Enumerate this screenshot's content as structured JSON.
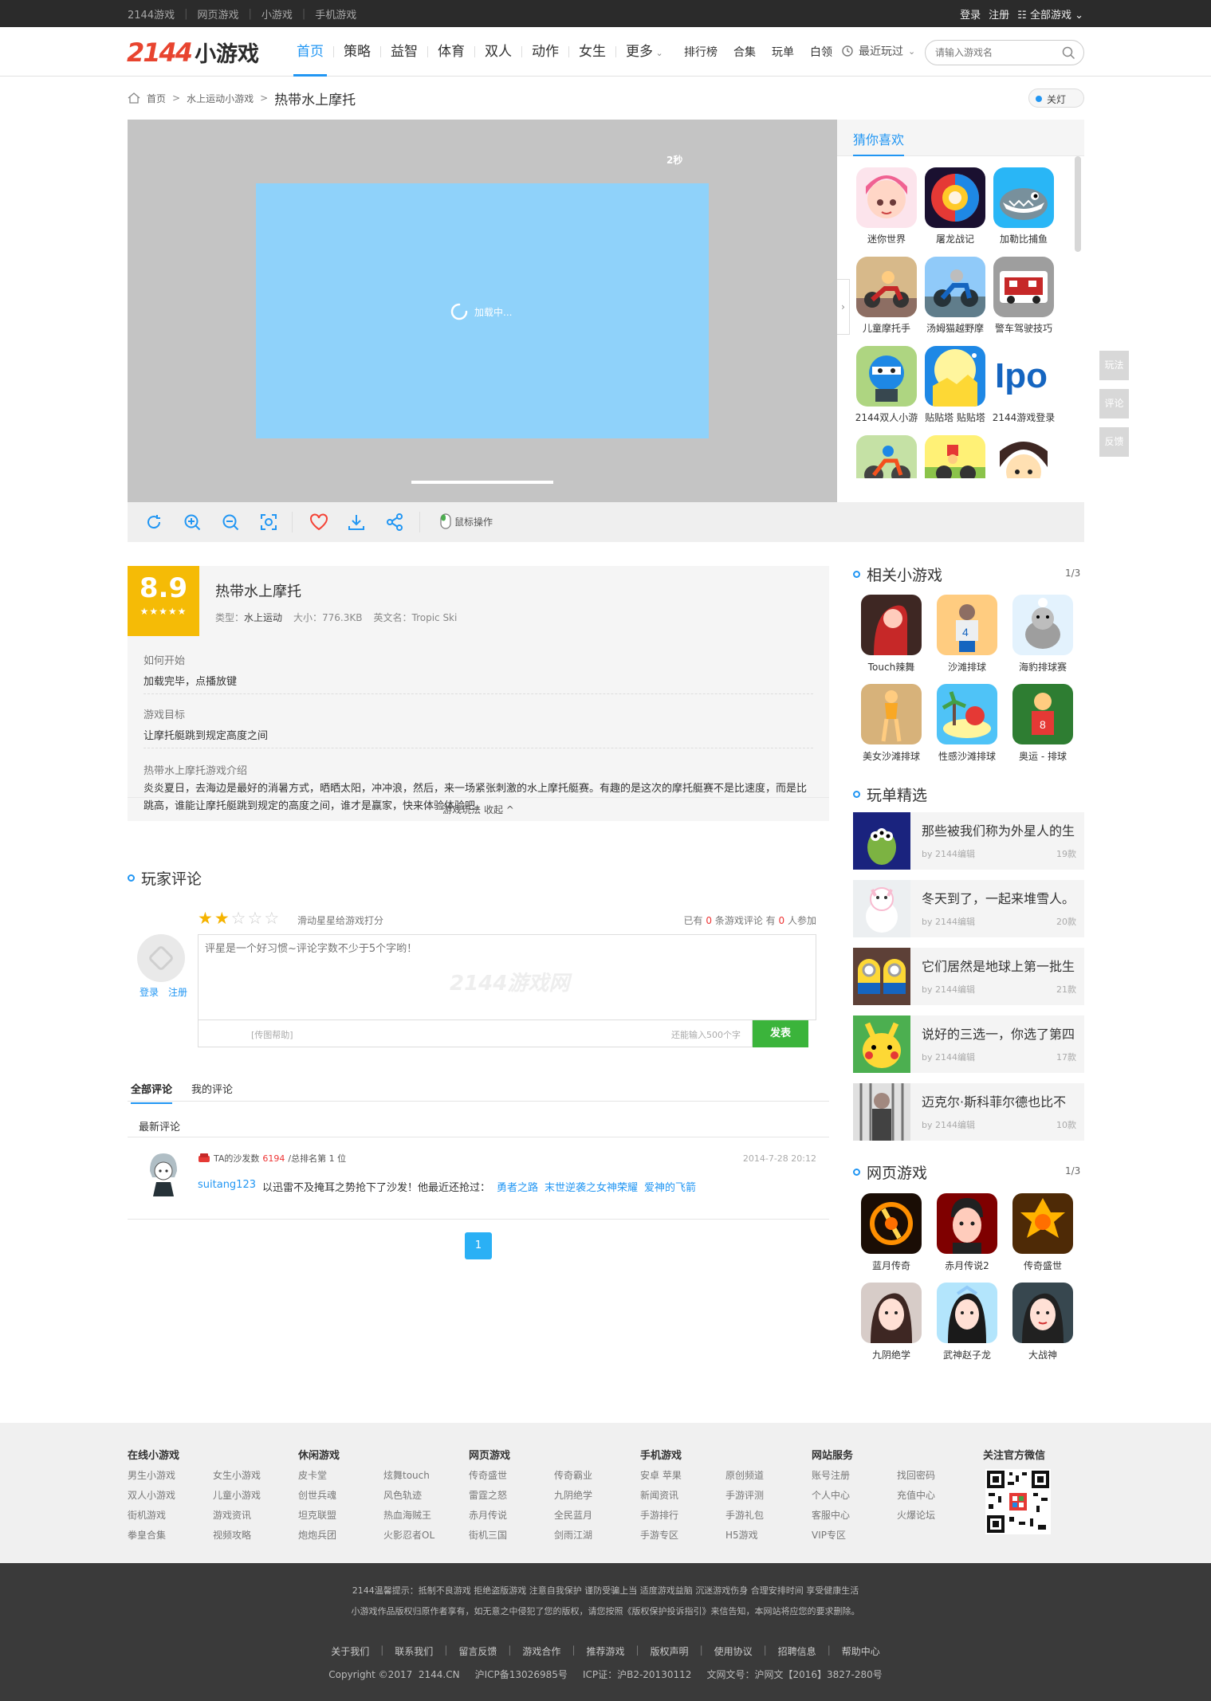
{
  "topbar": {
    "left": [
      "2144游戏",
      "网页游戏",
      "小游戏",
      "手机游戏"
    ],
    "login": "登录",
    "register": "注册",
    "all_games": "全部游戏"
  },
  "header": {
    "logo_num": "2144",
    "logo_text": "小游戏",
    "nav": [
      "首页",
      "策略",
      "益智",
      "体育",
      "双人",
      "动作",
      "女生",
      "更多"
    ],
    "nav_active": 0,
    "nav2": [
      "排行榜",
      "合集",
      "玩单",
      "白领"
    ],
    "recent": "最近玩过",
    "search_placeholder": "请输入游戏名"
  },
  "breadcrumb": {
    "home": "首页",
    "category": "水上运动小游戏",
    "current": "热带水上摩托",
    "light_btn": "关灯"
  },
  "game": {
    "countdown": "2秒",
    "loading": "加载中..."
  },
  "guess": {
    "title": "猜你喜欢",
    "items": [
      "迷你世界",
      "屠龙战记",
      "加勒比捕鱼",
      "儿童摩托手",
      "汤姆猫越野摩",
      "警车驾驶技巧",
      "2144双人小游",
      "贴贴塔 贴贴塔",
      "2144游戏登录",
      "",
      "",
      ""
    ]
  },
  "toolbar": {
    "mouse": "鼠标操作"
  },
  "info": {
    "score": "8.9",
    "stars": "★★★★★",
    "name": "热带水上摩托",
    "type_label": "类型：",
    "type": "水上运动",
    "size": "大小：776.3KB",
    "en_name": "英文名：Tropic Ski",
    "how_title": "如何开始",
    "how": "加载完毕，点播放键",
    "goal_title": "游戏目标",
    "goal": "让摩托艇跳到规定高度之间",
    "intro_title": "热带水上摩托游戏介绍",
    "intro": "炎炎夏日，去海边是最好的消暑方式，晒晒太阳，冲冲浪，然后，来一场紧张刺激的水上摩托艇赛。有趣的是这次的摩托艇赛不是比速度，而是比跳高，谁能让摩托艇跳到规定的高度之间，谁才是赢家，快来体验体验吧。",
    "toggle": "游戏玩法 收起 ^"
  },
  "comments": {
    "title": "玩家评论",
    "rating_stars": 2,
    "rating_hint": "滑动星星给游戏打分",
    "count_pre": "已有",
    "count_num": "0",
    "count_mid": "条游戏评论 有",
    "count_num2": "0",
    "count_post": "人参加",
    "login": "登录",
    "register": "注册",
    "placeholder": "评星是一个好习惯~评论字数不少于5个字哟！",
    "watermark": "2144游戏网",
    "pic_help": "[传图帮助]",
    "remain": "还能输入500个字",
    "send": "发表",
    "tab_all": "全部评论",
    "tab_mine": "我的评论",
    "newest": "最新评论",
    "item": {
      "info_pre": "TA的沙发数",
      "sofa": "6194",
      "info_post": "/总排名第 1 位",
      "time": "2014-7-28 20:12",
      "user": "suitang123",
      "text": "以迅雷不及掩耳之势抢下了沙发！他最近还抢过：",
      "links": [
        "勇者之路",
        "末世逆袭之女神荣耀",
        "爱神的飞箭"
      ]
    },
    "page": "1"
  },
  "related": {
    "title": "相关小游戏",
    "page": "1/3",
    "items": [
      "Touch辣舞",
      "沙滩排球",
      "海豹排球赛",
      "美女沙滩排球",
      "性感沙滩排球",
      "奥运 - 排球"
    ]
  },
  "wandan": {
    "title": "玩单精选",
    "items": [
      {
        "title": "那些被我们称为外星人的生",
        "by": "by 2144编辑",
        "count": "19款"
      },
      {
        "title": "冬天到了，一起来堆雪人。",
        "by": "by 2144编辑",
        "count": "20款"
      },
      {
        "title": "它们居然是地球上第一批生",
        "by": "by 2144编辑",
        "count": "21款"
      },
      {
        "title": "说好的三选一，你选了第四",
        "by": "by 2144编辑",
        "count": "17款"
      },
      {
        "title": "迈克尔·斯科菲尔德也比不",
        "by": "by 2144编辑",
        "count": "10款"
      }
    ]
  },
  "webgames": {
    "title": "网页游戏",
    "page": "1/3",
    "items": [
      "蓝月传奇",
      "赤月传说2",
      "传奇盛世",
      "九阴绝学",
      "武神赵子龙",
      "大战神"
    ]
  },
  "side": [
    "玩法",
    "评论",
    "反馈"
  ],
  "footer": {
    "cols": [
      {
        "title": "在线小游戏",
        "items": [
          "男生小游戏",
          "女生小游戏",
          "双人小游戏",
          "儿童小游戏",
          "街机游戏",
          "游戏资讯",
          "拳皇合集",
          "视频攻略"
        ]
      },
      {
        "title": "休闲游戏",
        "items": [
          "皮卡堂",
          "炫舞touch",
          "创世兵魂",
          "风色轨迹",
          "坦克联盟",
          "热血海贼王",
          "炮炮兵团",
          "火影忍者OL"
        ]
      },
      {
        "title": "网页游戏",
        "items": [
          "传奇盛世",
          "传奇霸业",
          "雷霆之怒",
          "九阴绝学",
          "赤月传说",
          "全民蓝月",
          "街机三国",
          "剑雨江湖"
        ]
      },
      {
        "title": "手机游戏",
        "items": [
          "安卓 苹果",
          "原创频道",
          "新闻资讯",
          "手游评测",
          "手游排行",
          "手游礼包",
          "手游专区",
          "H5游戏"
        ]
      },
      {
        "title": "网站服务",
        "items": [
          "账号注册",
          "找回密码",
          "个人中心",
          "充值中心",
          "客服中心",
          "火爆论坛",
          "VIP专区",
          ""
        ]
      }
    ],
    "wechat_title": "关注官方微信"
  },
  "bottom": {
    "tip1": "2144温馨提示：抵制不良游戏 拒绝盗版游戏 注意自我保护 谨防受骗上当 适度游戏益脑 沉迷游戏伤身 合理安排时间 享受健康生活",
    "tip2": "小游戏作品版权归原作者享有，如无意之中侵犯了您的版权，请您按照《版权保护投诉指引》来信告知，本网站将应您的要求删除。",
    "links": [
      "关于我们",
      "联系我们",
      "留言反馈",
      "游戏合作",
      "推荐游戏",
      "版权声明",
      "使用协议",
      "招聘信息",
      "帮助中心"
    ],
    "copyright": "Copyright ©2017  2144.CN     沪ICP备13026985号     ICP证：沪B2-20130112     文网文号：沪网文【2016】3827-280号"
  },
  "colors": {
    "accent": "#2196f3",
    "score_bg": "#f5bb06",
    "send_btn": "#3bb43b",
    "game_screen": "#8fd2fa"
  }
}
